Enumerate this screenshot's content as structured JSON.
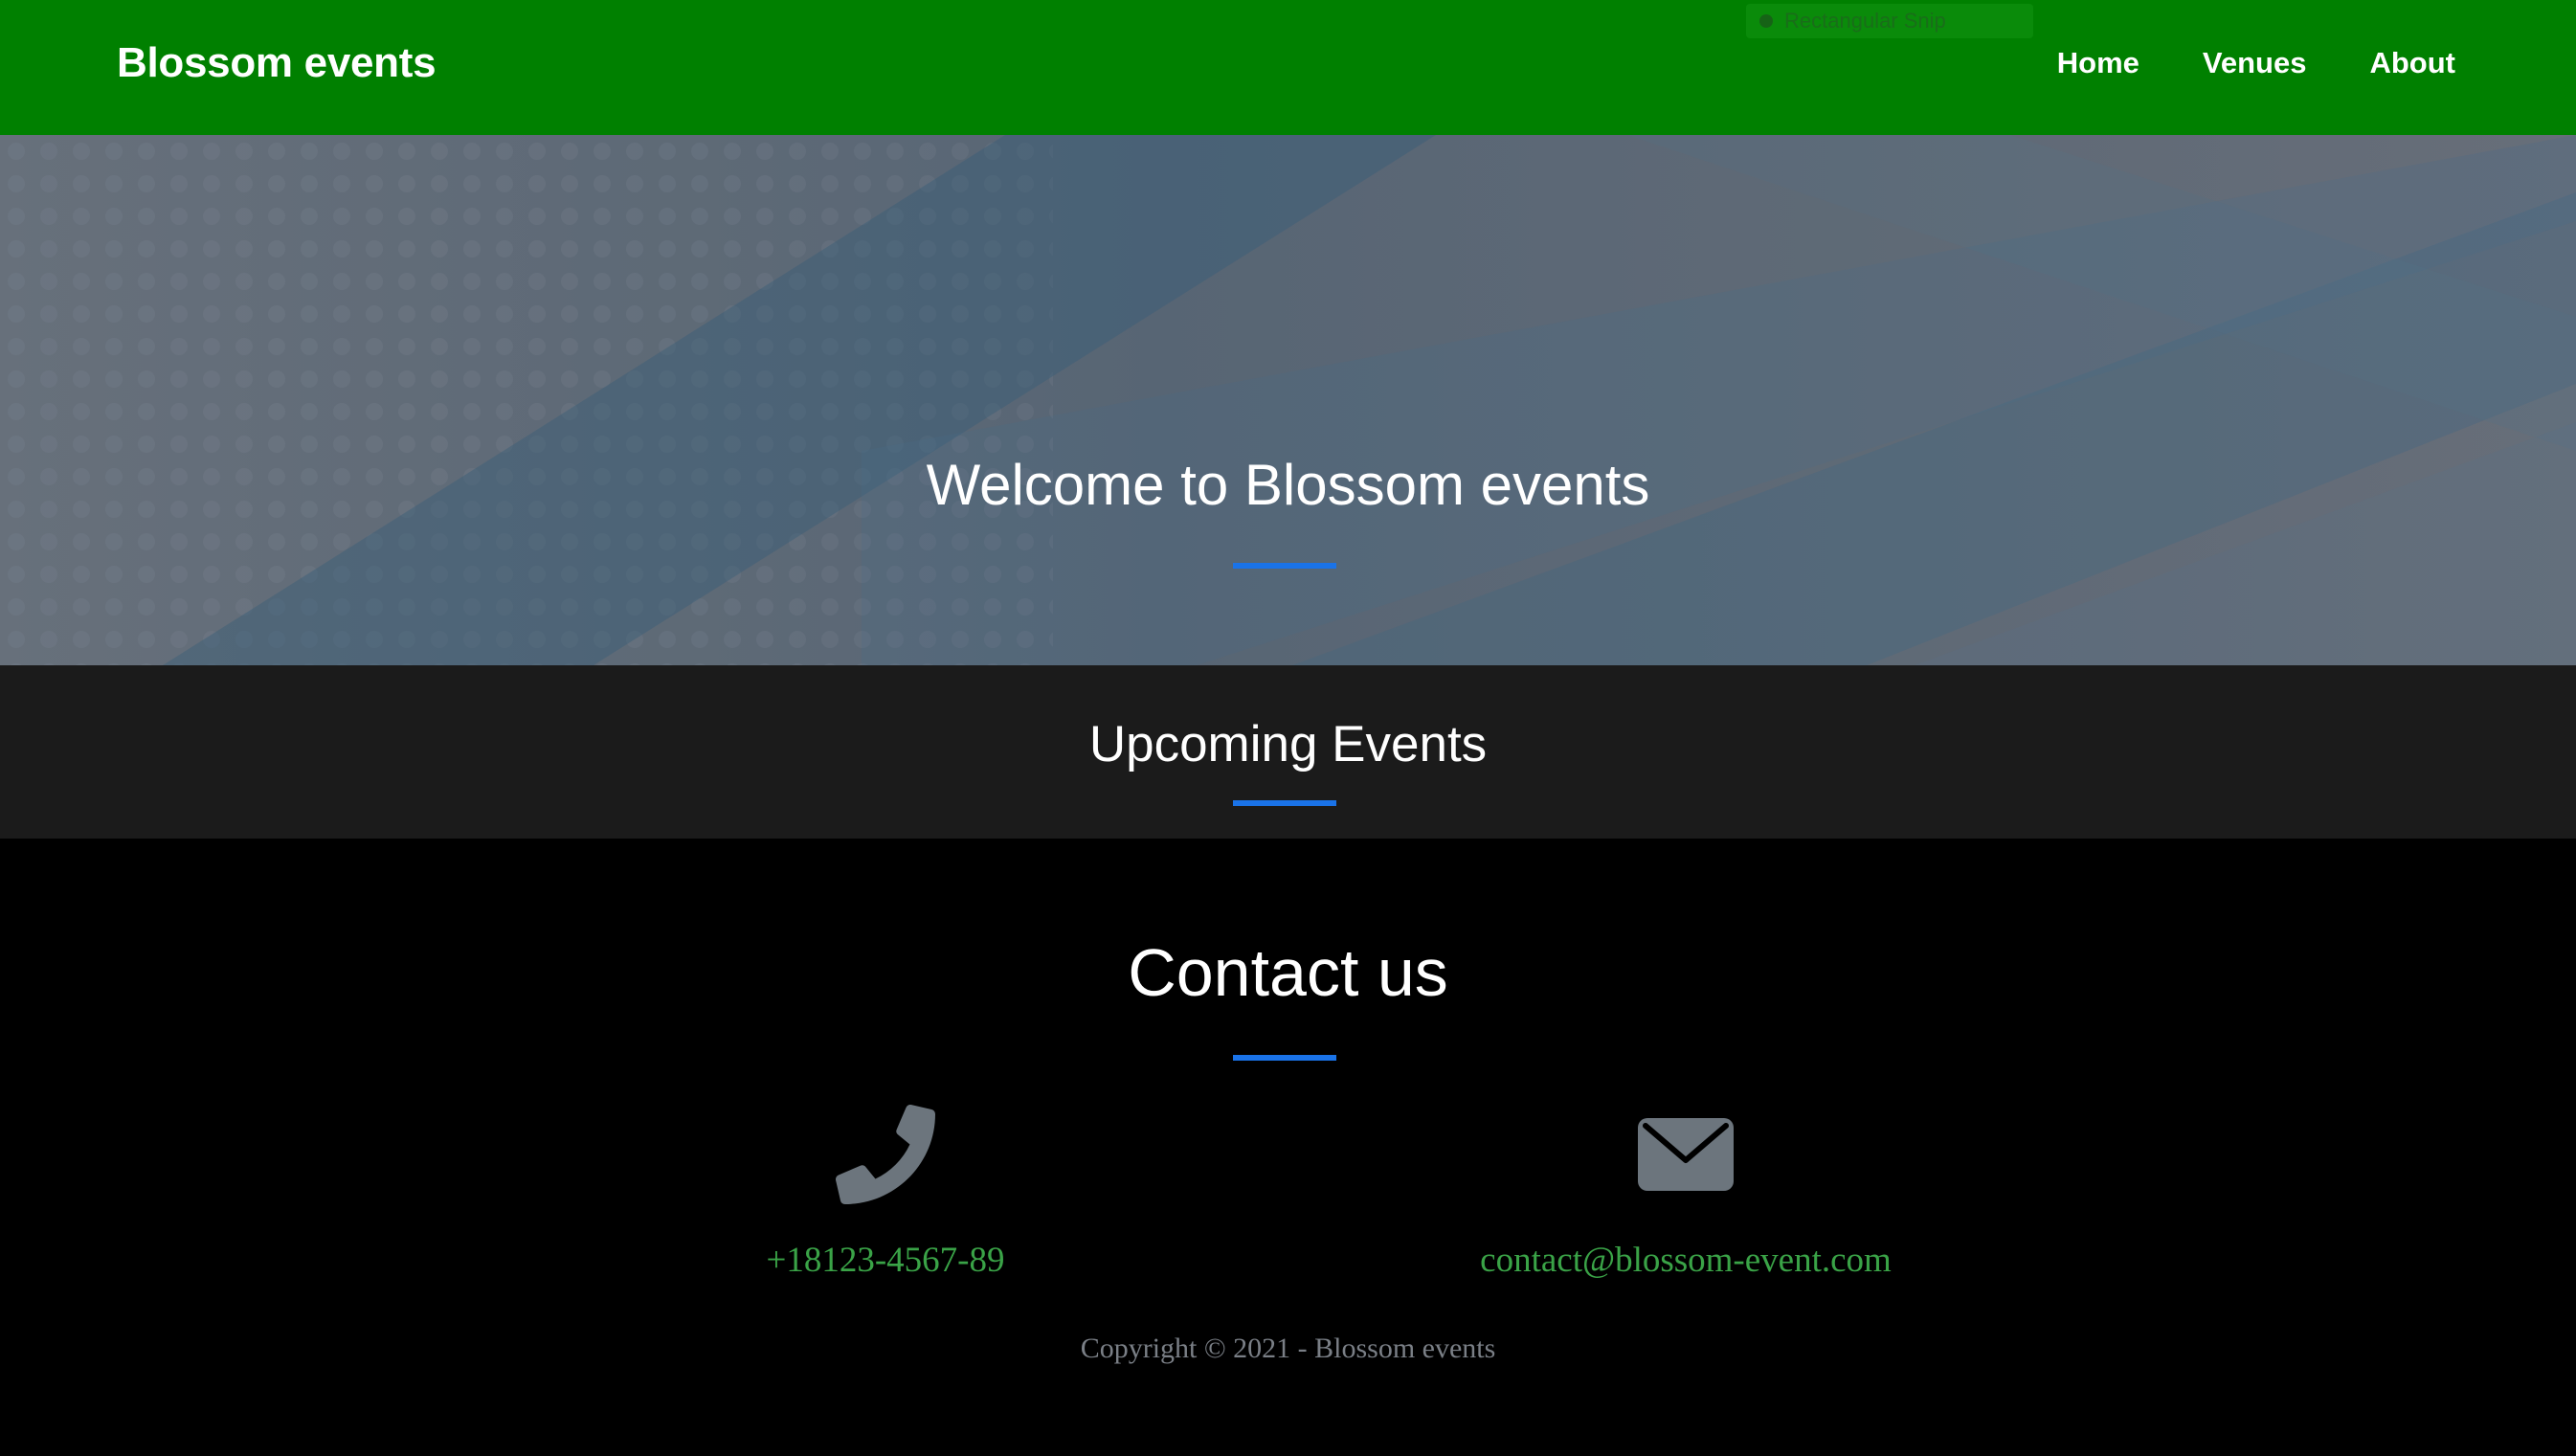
{
  "navbar": {
    "brand": "Blossom events",
    "links": [
      "Home",
      "Venues",
      "About"
    ],
    "snip_overlay": "Rectangular Snip"
  },
  "hero": {
    "title": "Welcome to Blossom events"
  },
  "upcoming": {
    "title": "Upcoming Events"
  },
  "contact": {
    "title": "Contact us",
    "phone": {
      "icon": "phone-icon",
      "text": "+18123-4567-89"
    },
    "email": {
      "icon": "envelope-icon",
      "text": "contact@blossom-event.com"
    },
    "copyright": "Copyright © 2021 - Blossom events"
  },
  "colors": {
    "navbar_bg": "#008000",
    "accent_divider": "#1a73e8",
    "link_green": "#3aa347",
    "upcoming_bg": "#1b1b1b",
    "contact_bg": "#000000",
    "icon_gray": "#6c757d"
  }
}
